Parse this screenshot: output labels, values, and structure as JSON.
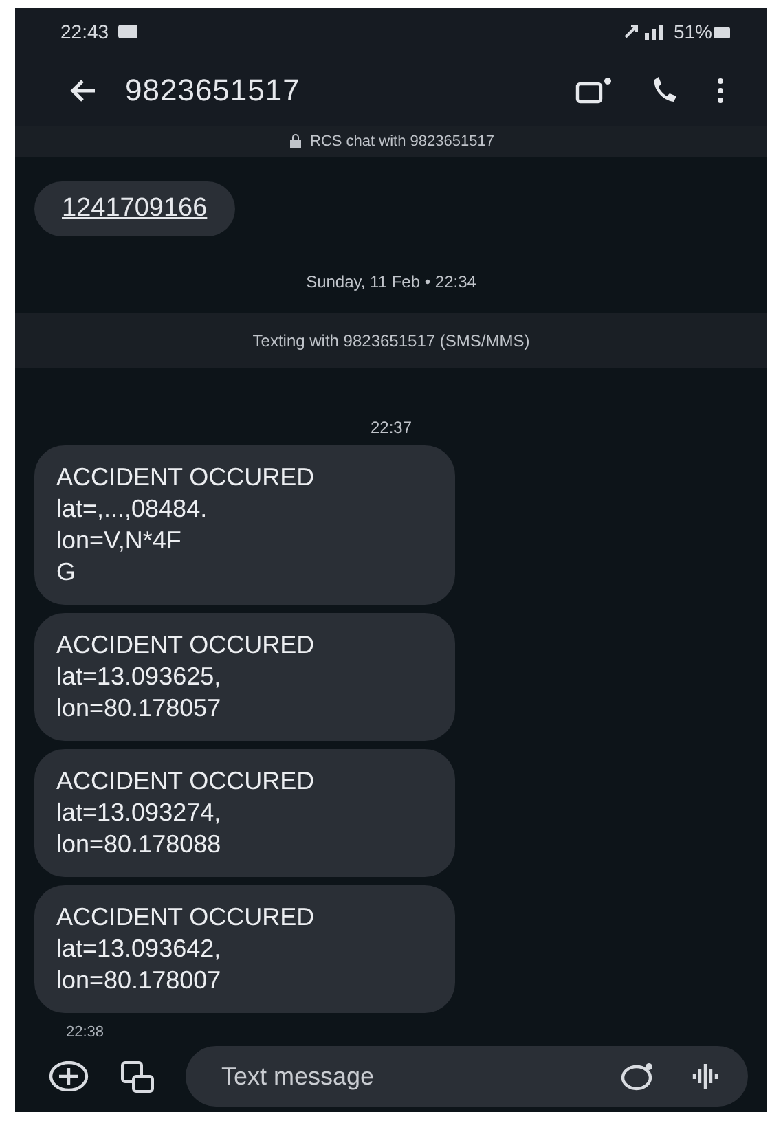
{
  "status_bar": {
    "time": "22:43",
    "battery": "51%"
  },
  "app_bar": {
    "title": "9823651517"
  },
  "rcs_banner": {
    "text": "RCS chat with 9823651517"
  },
  "items": [
    {
      "kind": "link",
      "lines": [
        "1241709166"
      ]
    },
    {
      "kind": "date",
      "text": "Sunday, 11 Feb • 22:34"
    },
    {
      "kind": "banner",
      "text": "Texting with 9823651517 (SMS/MMS)"
    },
    {
      "kind": "time",
      "text": "22:37"
    },
    {
      "kind": "bubble",
      "lines": [
        "ACCIDENT OCCURED",
        "lat=,...,08484.",
        "lon=V,N*4F",
        "G"
      ]
    },
    {
      "kind": "bubble",
      "lines": [
        "ACCIDENT OCCURED",
        "lat=13.093625,",
        "lon=80.178057"
      ]
    },
    {
      "kind": "bubble",
      "lines": [
        "ACCIDENT OCCURED",
        "lat=13.093274,",
        "lon=80.178088"
      ]
    },
    {
      "kind": "bubble",
      "lines": [
        "ACCIDENT OCCURED",
        "lat=13.093642,",
        "lon=80.178007"
      ]
    },
    {
      "kind": "stamp",
      "text": "22:38"
    }
  ],
  "composer": {
    "placeholder": "Text message"
  }
}
